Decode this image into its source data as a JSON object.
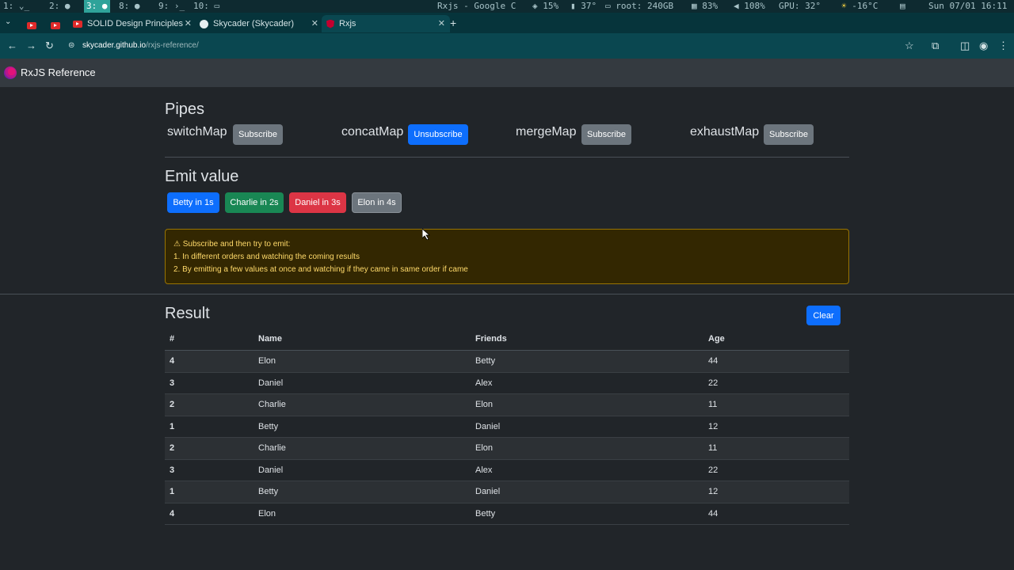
{
  "system_bar": {
    "workspaces": [
      "1:",
      "2:",
      "3:",
      "8:",
      "9:",
      "10:"
    ],
    "window_title": "Rxjs - Google C",
    "cpu": "15%",
    "temp": "37°",
    "disk": "root: 240GB",
    "memory": "83%",
    "volume": "108%",
    "gpu": "GPU: 32°",
    "weather": "-16°C",
    "datetime": "Sun 07/01 16:11"
  },
  "browser": {
    "tabs": [
      {
        "label": "SOLID Design Principles"
      },
      {
        "label": "Skycader (Skycader)"
      },
      {
        "label": "Rxjs"
      }
    ],
    "url_host": "skycader.github.io",
    "url_path": "/rxjs-reference/"
  },
  "app": {
    "title": "RxJS Reference"
  },
  "pipes": {
    "heading": "Pipes",
    "items": [
      {
        "name": "switchMap",
        "button": "Subscribe"
      },
      {
        "name": "concatMap",
        "button": "Unsubscribe"
      },
      {
        "name": "mergeMap",
        "button": "Subscribe"
      },
      {
        "name": "exhaustMap",
        "button": "Subscribe"
      }
    ]
  },
  "emit": {
    "heading": "Emit value",
    "buttons": [
      "Betty in 1s",
      "Charlie in 2s",
      "Daniel in 3s",
      "Elon in 4s"
    ]
  },
  "alert": {
    "title": "Subscribe and then try to emit:",
    "line1": "1. In different orders and watching the coming results",
    "line2": "2. By emitting a few values at once and watching if they came in same order if came"
  },
  "result": {
    "heading": "Result",
    "clear_label": "Clear",
    "columns": [
      "#",
      "Name",
      "Friends",
      "Age"
    ],
    "rows": [
      [
        "4",
        "Elon",
        "Betty",
        "44"
      ],
      [
        "3",
        "Daniel",
        "Alex",
        "22"
      ],
      [
        "2",
        "Charlie",
        "Elon",
        "11"
      ],
      [
        "1",
        "Betty",
        "Daniel",
        "12"
      ],
      [
        "2",
        "Charlie",
        "Elon",
        "11"
      ],
      [
        "3",
        "Daniel",
        "Alex",
        "22"
      ],
      [
        "1",
        "Betty",
        "Daniel",
        "12"
      ],
      [
        "4",
        "Elon",
        "Betty",
        "44"
      ]
    ]
  }
}
